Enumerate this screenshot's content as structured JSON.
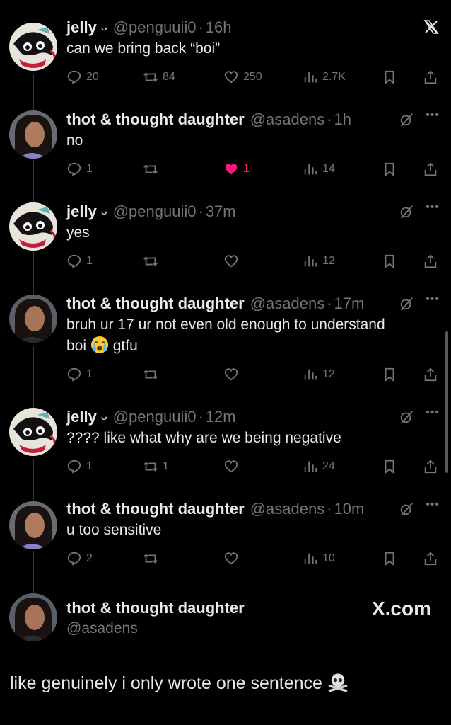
{
  "close_icon": "x-close-icon",
  "tweets": [
    {
      "name": "jelly",
      "badge": "ᴗ",
      "handle": "@penguuii0",
      "time": "16h",
      "text": "can we bring back “boi”",
      "replies": "20",
      "retweets": "84",
      "likes": "250",
      "views": "2.7K",
      "liked": false
    },
    {
      "name": "thot & thought daughter",
      "handle": "@asadens",
      "time": "1h",
      "text": "no",
      "replies": "1",
      "retweets": "",
      "likes": "1",
      "views": "14",
      "liked": true
    },
    {
      "name": "jelly",
      "badge": "ᴗ",
      "handle": "@penguuii0",
      "time": "37m",
      "text": "yes",
      "replies": "1",
      "retweets": "",
      "likes": "",
      "views": "12",
      "liked": false
    },
    {
      "name": "thot & thought daughter",
      "handle": "@asadens",
      "time": "17m",
      "text_line1": "bruh ur 17 ur not even old enough to understand",
      "text_line2_pre": "boi",
      "text_line2_post": "gtfu",
      "replies": "1",
      "retweets": "",
      "likes": "",
      "views": "12",
      "liked": false
    },
    {
      "name": "jelly",
      "badge": "ᴗ",
      "handle": "@penguuii0",
      "time": "12m",
      "text": "???? like what why are we being negative",
      "replies": "1",
      "retweets": "1",
      "likes": "",
      "views": "24",
      "liked": false
    },
    {
      "name": "thot & thought daughter",
      "handle": "@asadens",
      "time": "10m",
      "text": "u too sensitive",
      "replies": "2",
      "retweets": "",
      "likes": "",
      "views": "10",
      "liked": false
    }
  ],
  "main": {
    "name": "thot & thought daughter",
    "handle": "@asadens",
    "watermark": "X.com",
    "text": "like genuinely i only wrote one sentence"
  },
  "colors": {
    "background": "#000000",
    "text": "#e7e9ea",
    "muted": "#71767b",
    "like": "#f91880"
  }
}
